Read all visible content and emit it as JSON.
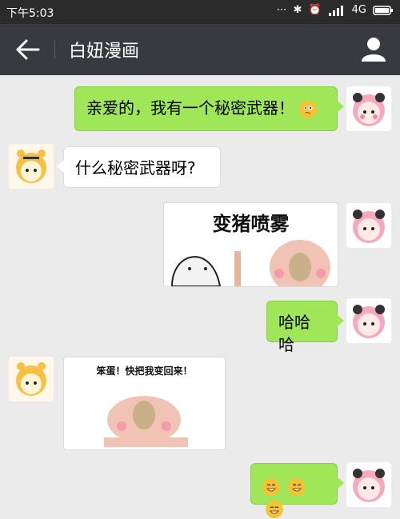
{
  "status_bar": {
    "time": "下午5:03",
    "network": "4G",
    "icons": [
      "dots-icon",
      "bluetooth-icon",
      "alarm-icon",
      "signal-icon",
      "battery-icon"
    ]
  },
  "header": {
    "title": "白妞漫画",
    "back_icon": "back-arrow-icon",
    "profile_icon": "profile-icon"
  },
  "messages": [
    {
      "side": "right",
      "type": "text",
      "text": "亲爱的，我有一个秘密武器！",
      "emoji": "thinking-emoji"
    },
    {
      "side": "left",
      "type": "text",
      "text": "什么秘密武器呀?"
    },
    {
      "side": "right",
      "type": "sticker",
      "caption": "变猪喷雾"
    },
    {
      "side": "right",
      "type": "text",
      "text": "哈哈哈"
    },
    {
      "side": "left",
      "type": "sticker",
      "caption": "笨蛋！快把我变回来！"
    },
    {
      "side": "right",
      "type": "emoji",
      "emojis": [
        "grin-emoji",
        "grin-emoji",
        "grin-emoji"
      ]
    }
  ],
  "colors": {
    "topbar": "#393a3f",
    "status": "#2b2b2b",
    "bg": "#ebebeb",
    "green": "#9fe658"
  }
}
